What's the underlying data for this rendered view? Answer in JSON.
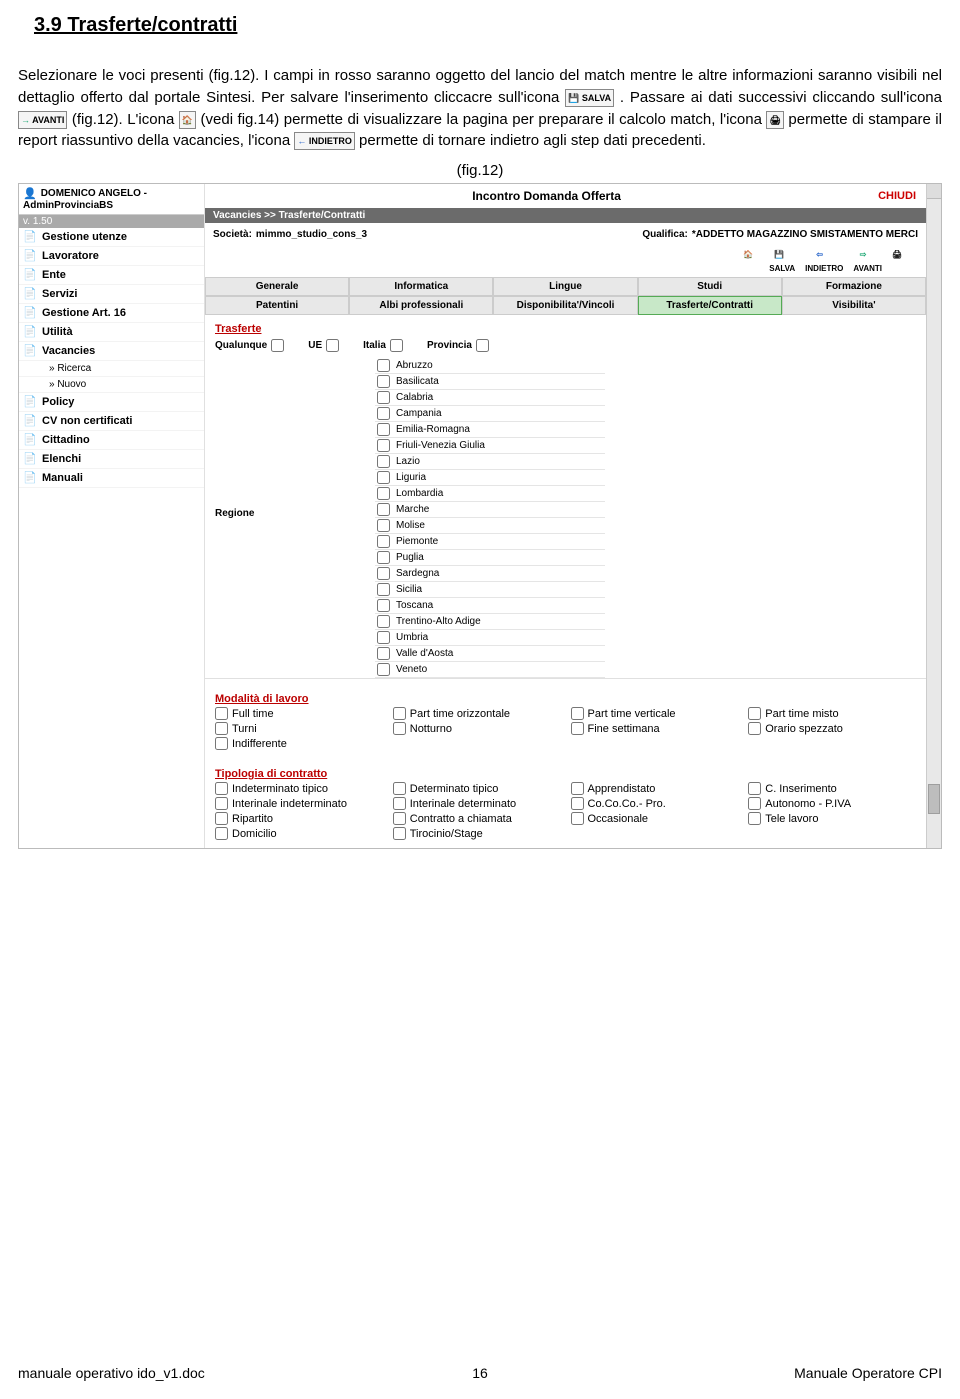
{
  "doc": {
    "section_title": "3.9 Trasferte/contratti",
    "p1a": "Selezionare le voci presenti (fig.12). I campi in rosso saranno oggetto del lancio del match mentre le altre informazioni saranno visibili nel dettaglio offerto dal portale Sintesi. Per salvare l'inserimento cliccacre sull'icona ",
    "icon_salva": "SALVA",
    "p1b": " . Passare ai dati successivi cliccando sull'icona ",
    "icon_avanti": "AVANTI",
    "p1c": " (fig.12). L'icona ",
    "p1d": " (vedi fig.14) permette di visualizzare la pagina per preparare il calcolo match,  l'icona ",
    "p1e": "  permette di stampare il report riassuntivo della vacancies, l'icona ",
    "icon_indietro": "INDIETRO",
    "p1f": " permette di tornare indietro agli step dati precedenti.",
    "fig_label": "(fig.12)"
  },
  "app": {
    "user_line1": "DOMENICO ANGELO -",
    "user_line2": "AdminProvinciaBS",
    "version": "v. 1.50",
    "title": "Incontro Domanda Offerta",
    "chiudi": "CHIUDI",
    "breadcrumb": "Vacancies >> Trasferte/Contratti",
    "societa_lbl": "Società:",
    "societa_val": "mimmo_studio_cons_3",
    "qualifica_lbl": "Qualifica:",
    "qualifica_val": "*ADDETTO MAGAZZINO SMISTAMENTO MERCI",
    "toolbar": {
      "salva": "SALVA",
      "indietro": "INDIETRO",
      "avanti": "AVANTI"
    },
    "sidebar": [
      {
        "label": "Gestione utenze"
      },
      {
        "label": "Lavoratore"
      },
      {
        "label": "Ente"
      },
      {
        "label": "Servizi"
      },
      {
        "label": "Gestione Art. 16"
      },
      {
        "label": "Utilità"
      },
      {
        "label": "Vacancies"
      },
      {
        "label": "» Ricerca",
        "sub": true
      },
      {
        "label": "» Nuovo",
        "sub": true
      },
      {
        "label": "Policy"
      },
      {
        "label": "CV non certificati"
      },
      {
        "label": "Cittadino"
      },
      {
        "label": "Elenchi"
      },
      {
        "label": "Manuali"
      }
    ],
    "tabs_row1": [
      "Generale",
      "Informatica",
      "Lingue",
      "Studi",
      "Formazione"
    ],
    "tabs_row2": [
      "Patentini",
      "Albi professionali",
      "Disponibilita'/Vincoli",
      "Trasferte/Contratti",
      "Visibilita'"
    ],
    "trasferte_h": "Trasferte",
    "top_checks": [
      "Qualunque",
      "UE",
      "Italia",
      "Provincia"
    ],
    "regione_lbl": "Regione",
    "regions": [
      "Abruzzo",
      "Basilicata",
      "Calabria",
      "Campania",
      "Emilia-Romagna",
      "Friuli-Venezia Giulia",
      "Lazio",
      "Liguria",
      "Lombardia",
      "Marche",
      "Molise",
      "Piemonte",
      "Puglia",
      "Sardegna",
      "Sicilia",
      "Toscana",
      "Trentino-Alto Adige",
      "Umbria",
      "Valle d'Aosta",
      "Veneto"
    ],
    "modalita_h": "Modalità di lavoro",
    "modalita": [
      "Full time",
      "Part time orizzontale",
      "Part time verticale",
      "Part time misto",
      "Turni",
      "Notturno",
      "Fine settimana",
      "Orario spezzato",
      "Indifferente"
    ],
    "tipologia_h": "Tipologia di contratto",
    "tipologia": [
      "Indeterminato tipico",
      "Determinato tipico",
      "Apprendistato",
      "C. Inserimento",
      "Interinale indeterminato",
      "Interinale determinato",
      "Co.Co.Co.- Pro.",
      "Autonomo - P.IVA",
      "Ripartito",
      "Contratto a chiamata",
      "Occasionale",
      "Tele lavoro",
      "Domicilio",
      "Tirocinio/Stage"
    ]
  },
  "footer": {
    "left": "manuale operativo ido_v1.doc",
    "center": "16",
    "right": "Manuale Operatore CPI"
  }
}
